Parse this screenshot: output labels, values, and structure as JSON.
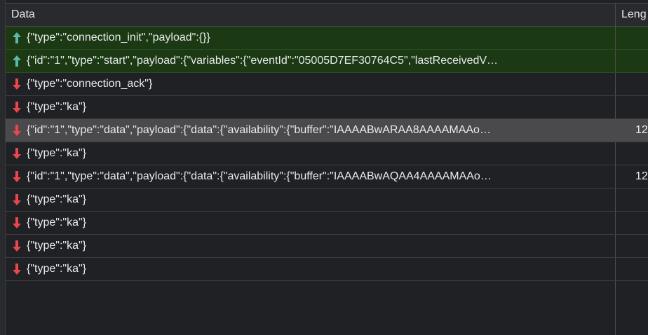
{
  "header": {
    "data_label": "Data",
    "length_label": "Leng"
  },
  "colors": {
    "sent_arrow": "#5cb8a8",
    "received_arrow": "#e8474d",
    "sent_row_bg": "#1b3a13",
    "selected_row_bg": "#4a4a4c"
  },
  "messages": [
    {
      "direction": "sent",
      "icon": "arrow-up-icon",
      "text": "{\"type\":\"connection_init\",\"payload\":{}}",
      "length": ""
    },
    {
      "direction": "sent",
      "icon": "arrow-up-icon",
      "text": "{\"id\":\"1\",\"type\":\"start\",\"payload\":{\"variables\":{\"eventId\":\"05005D7EF30764C5\",\"lastReceivedV…",
      "length": ""
    },
    {
      "direction": "received",
      "icon": "arrow-down-icon",
      "text": "{\"type\":\"connection_ack\"}",
      "length": ""
    },
    {
      "direction": "received",
      "icon": "arrow-down-icon",
      "text": "{\"type\":\"ka\"}",
      "length": ""
    },
    {
      "direction": "received",
      "icon": "arrow-down-icon",
      "text": "{\"id\":\"1\",\"type\":\"data\",\"payload\":{\"data\":{\"availability\":{\"buffer\":\"IAAAABwARAA8AAAAMAAo…",
      "length": "12",
      "selected": true
    },
    {
      "direction": "received",
      "icon": "arrow-down-icon",
      "text": "{\"type\":\"ka\"}",
      "length": ""
    },
    {
      "direction": "received",
      "icon": "arrow-down-icon",
      "text": "{\"id\":\"1\",\"type\":\"data\",\"payload\":{\"data\":{\"availability\":{\"buffer\":\"IAAAABwAQAA4AAAAMAAo…",
      "length": "12"
    },
    {
      "direction": "received",
      "icon": "arrow-down-icon",
      "text": "{\"type\":\"ka\"}",
      "length": ""
    },
    {
      "direction": "received",
      "icon": "arrow-down-icon",
      "text": "{\"type\":\"ka\"}",
      "length": ""
    },
    {
      "direction": "received",
      "icon": "arrow-down-icon",
      "text": "{\"type\":\"ka\"}",
      "length": ""
    },
    {
      "direction": "received",
      "icon": "arrow-down-icon",
      "text": "{\"type\":\"ka\"}",
      "length": ""
    }
  ]
}
